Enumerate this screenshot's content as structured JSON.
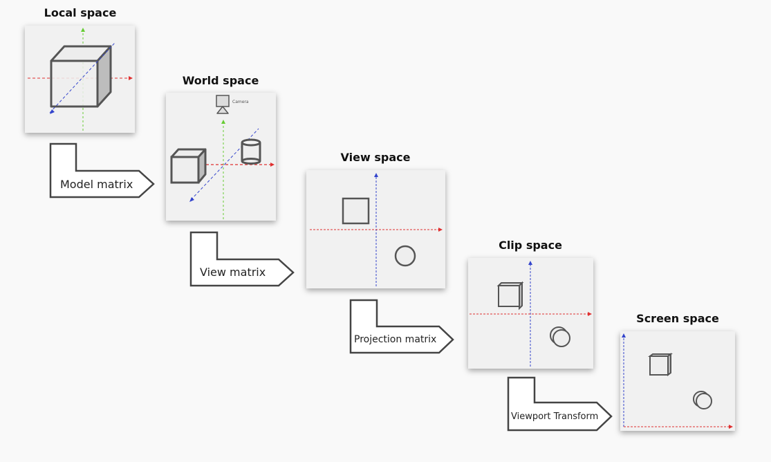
{
  "stages": {
    "local": {
      "title": "Local space"
    },
    "world": {
      "title": "World space",
      "camera_label": "Camera"
    },
    "view": {
      "title": "View space"
    },
    "clip": {
      "title": "Clip space"
    },
    "screen": {
      "title": "Screen space"
    }
  },
  "transforms": {
    "model": "Model matrix",
    "view": "View matrix",
    "projection": "Projection matrix",
    "viewport": "Viewport Transform"
  },
  "colors": {
    "x_axis": "#e03030",
    "y_axis": "#66cc33",
    "z_axis": "#3344cc",
    "outline": "#555555",
    "panel": "#f1f1f1"
  }
}
